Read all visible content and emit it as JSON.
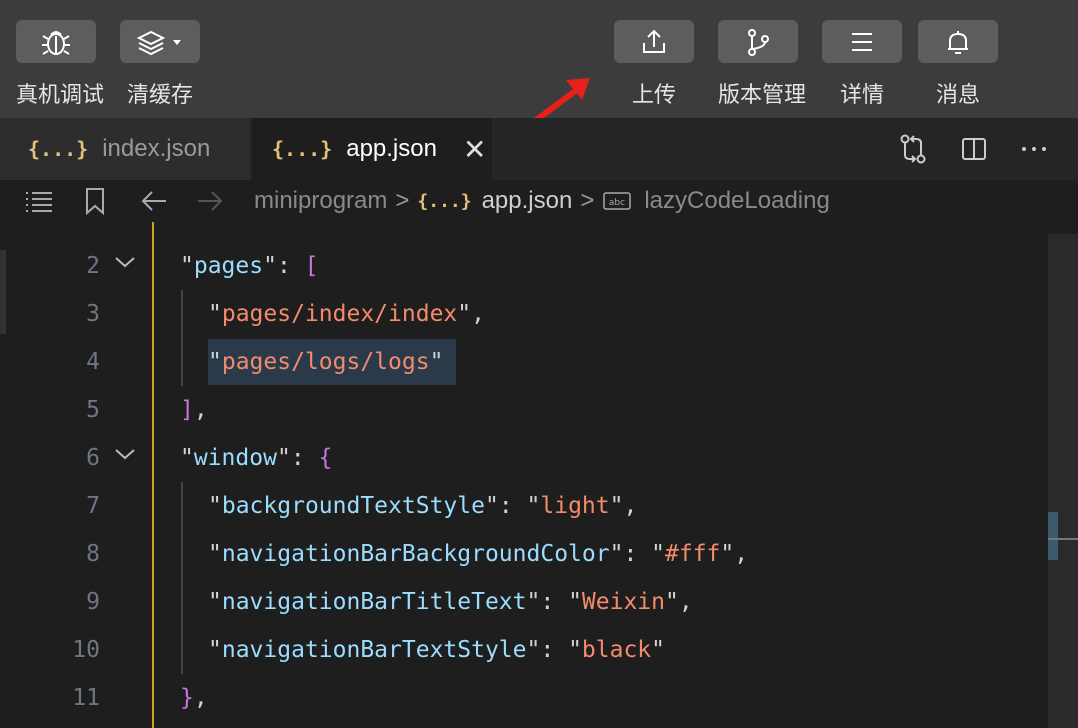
{
  "toolbar": {
    "left": [
      {
        "label": "真机调试",
        "icon": "bug-icon"
      },
      {
        "label": "清缓存",
        "icon": "layers-icon"
      }
    ],
    "right": [
      {
        "label": "上传",
        "icon": "upload-icon"
      },
      {
        "label": "版本管理",
        "icon": "branch-icon"
      },
      {
        "label": "详情",
        "icon": "menu-icon"
      },
      {
        "label": "消息",
        "icon": "bell-icon"
      }
    ]
  },
  "tabs": [
    {
      "braces": "{...}",
      "label": "index.json",
      "active": false
    },
    {
      "braces": "{...}",
      "label": "app.json",
      "active": true,
      "close": "✕"
    }
  ],
  "breadcrumb": {
    "folder": "miniprogram",
    "braces": "{...}",
    "file": "app.json",
    "symbol": "lazyCodeLoading"
  },
  "editor": {
    "lines": [
      {
        "n": "2",
        "fold": true
      },
      {
        "n": "3"
      },
      {
        "n": "4"
      },
      {
        "n": "5"
      },
      {
        "n": "6",
        "fold": true
      },
      {
        "n": "7"
      },
      {
        "n": "8"
      },
      {
        "n": "9"
      },
      {
        "n": "10"
      },
      {
        "n": "11"
      }
    ],
    "tokens": {
      "pages_key": "pages",
      "index_page": "pages/index/index",
      "logs_page": "pages/logs/logs",
      "window_key": "window",
      "bg_key": "backgroundTextStyle",
      "bg_val": "light",
      "navbg_key": "navigationBarBackgroundColor",
      "navbg_val": "#fff",
      "navtitle_key": "navigationBarTitleText",
      "navtitle_val": "Weixin",
      "navstyle_key": "navigationBarTextStyle",
      "navstyle_val": "black"
    }
  },
  "colors": {
    "accent_arrow": "#e8201c",
    "json_key": "#9cdcfe",
    "json_string": "#f28b6c",
    "bracket": "#c678dd",
    "braces_icon": "#e5c07b"
  }
}
